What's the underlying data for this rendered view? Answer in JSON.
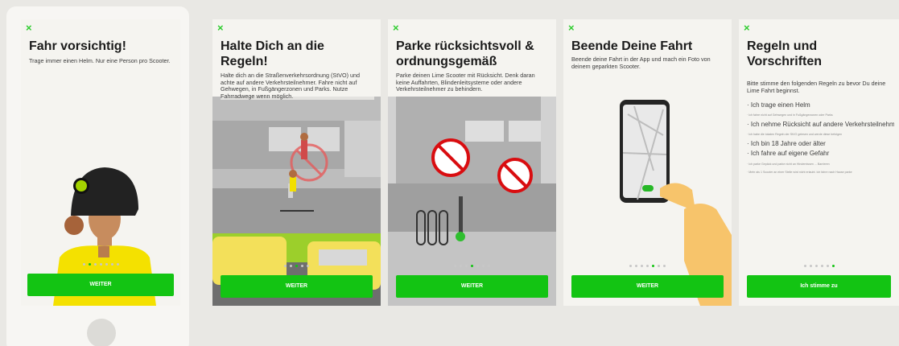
{
  "colors": {
    "accent": "#13C413",
    "background": "#E9E8E4",
    "screen": "#F5F4F0"
  },
  "icons": {
    "close": "close-icon"
  },
  "close_glyph": "×",
  "screens": [
    {
      "title": "Fahr vorsichtig!",
      "body": "Trage immer einen Helm. Nur eine Person pro Scooter.",
      "button": "WEITER",
      "dots_total": 7,
      "dots_active": 2
    },
    {
      "title": "Halte Dich an die Regeln!",
      "body": "Halte dich an die Straßenverkehrsordnung (StVO) und achte auf andere Verkehrsteilnehmer. Fahre nicht auf Gehwegen, in Fußgängerzonen und Parks. Nutze Fahrradwege wenn möglich.",
      "button": "WEITER",
      "dots_total": 5,
      "dots_active": 3
    },
    {
      "title": "Parke rücksichtsvoll & ordnungsgemäß",
      "body": "Parke deinen Lime Scooter mit Rücksicht. Denk daran keine Auffahrten, Blindenleitsysteme oder andere Verkehrsteilnehmer zu behindern.",
      "button": "WEITER",
      "dots_total": 7,
      "dots_active": 4
    },
    {
      "title": "Beende Deine Fahrt",
      "body": "Beende deine Fahrt in der App und mach ein Foto von deinem geparkten Scooter.",
      "button": "WEITER",
      "dots_total": 7,
      "dots_active": 5
    },
    {
      "title": "Regeln und Vorschriften",
      "body": "Bitte stimme den folgenden Regeln zu bevor Du deine Lime Fahrt beginnst.",
      "rules": [
        {
          "text": "· Ich trage einen Helm",
          "size": "big"
        },
        {
          "text": "· Ich fahre nicht auf Gehwegen und in Fußgängerzonen oder Parks",
          "size": "small"
        },
        {
          "text": "· Ich nehme Rücksicht auf andere Verkehrsteilnehmer",
          "size": "big"
        },
        {
          "text": "· Ich habe die lokalen Regeln der StVO gelesen und werde diese befolgen",
          "size": "small"
        },
        {
          "text": "· Ich bin 18 Jahre oder älter",
          "size": "big"
        },
        {
          "text": "· Ich fahre auf eigene Gefahr",
          "size": "big"
        },
        {
          "text": "· Ich parke Gepäck und parke nicht an Hindernissen ... Barrieren",
          "size": "small"
        },
        {
          "text": "· Mehr als 1 Scooter an einer Stelle wird nicht erlaubt. Ich fahre nach Hause parke",
          "size": "small"
        }
      ],
      "button": "Ich stimme zu",
      "dots_total": 6,
      "dots_active": 6
    }
  ]
}
